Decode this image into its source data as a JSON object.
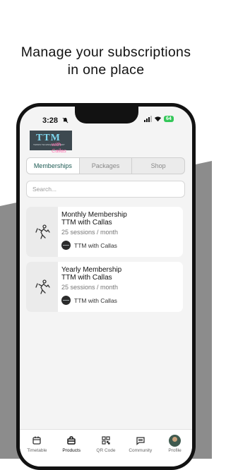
{
  "headline": {
    "line1": "Manage your subscriptions",
    "line2": "in one place"
  },
  "status_bar": {
    "time": "3:28",
    "battery": "64"
  },
  "logo": {
    "main": "TTM",
    "sub": "TENNIS TECHNIQUE MASTERY",
    "script": "with Callas"
  },
  "tabs": [
    {
      "label": "Memberships",
      "active": true
    },
    {
      "label": "Packages",
      "active": false
    },
    {
      "label": "Shop",
      "active": false
    }
  ],
  "search": {
    "placeholder": "Search..."
  },
  "memberships": [
    {
      "title_line1": "Monthly Membership",
      "title_line2": "TTM with Callas",
      "sessions": "25 sessions / month",
      "owner": "TTM with Callas",
      "icon": "tennis-player-icon"
    },
    {
      "title_line1": "Yearly Membership",
      "title_line2": "TTM with Callas",
      "sessions": "25 sessions / month",
      "owner": "TTM with Callas",
      "icon": "tennis-player-icon"
    }
  ],
  "nav": [
    {
      "label": "Timetable",
      "icon": "calendar-icon"
    },
    {
      "label": "Products",
      "icon": "bag-icon",
      "active": true
    },
    {
      "label": "QR Code",
      "icon": "qr-code-icon"
    },
    {
      "label": "Community",
      "icon": "chat-icon"
    },
    {
      "label": "Profile",
      "icon": "avatar"
    }
  ],
  "colors": {
    "accent": "#1c5a53",
    "battery": "#34c759",
    "background_gray": "#8c8c8c"
  }
}
